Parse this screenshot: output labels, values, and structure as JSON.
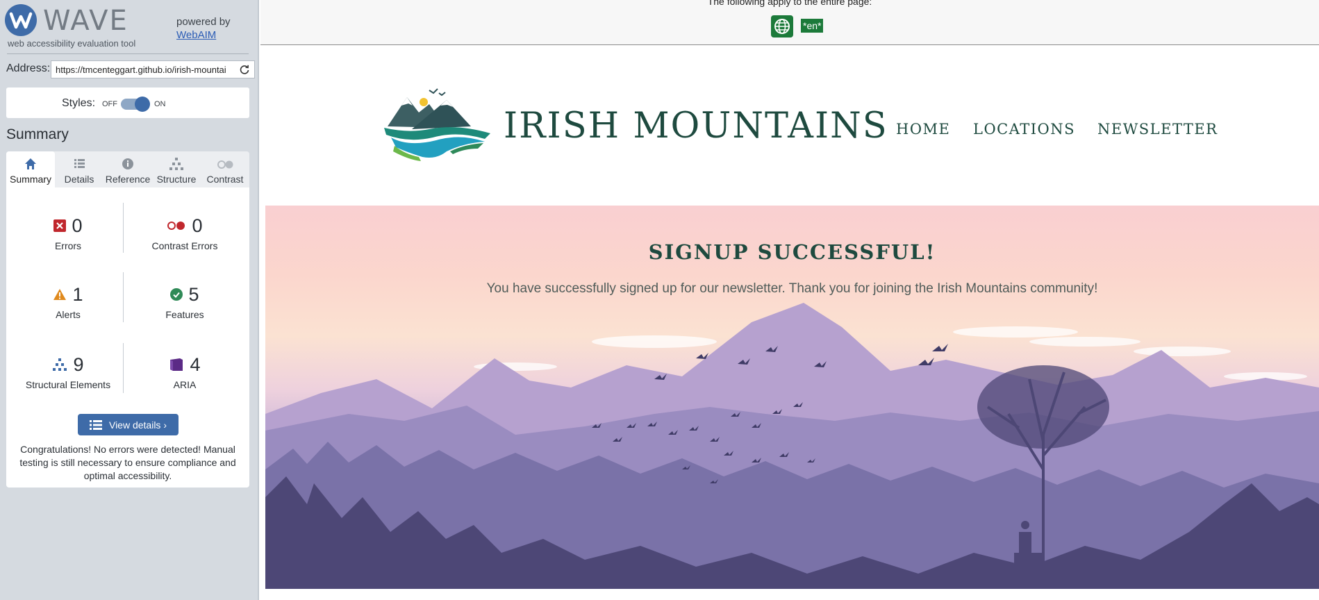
{
  "wave": {
    "title": "WAVE",
    "subtitle": "web accessibility evaluation tool",
    "powered_by": "powered by",
    "webaim_link": "WebAIM",
    "address_label": "Address:",
    "address_value": "https://tmcenteggart.github.io/irish-mountai",
    "styles_label": "Styles:",
    "styles_off": "OFF",
    "styles_on": "ON",
    "styles_state": "on",
    "summary_heading": "Summary",
    "tabs": [
      {
        "label": "Summary",
        "icon": "home-icon"
      },
      {
        "label": "Details",
        "icon": "list-icon"
      },
      {
        "label": "Reference",
        "icon": "info-icon"
      },
      {
        "label": "Structure",
        "icon": "structure-icon"
      },
      {
        "label": "Contrast",
        "icon": "contrast-icon"
      }
    ],
    "stats": {
      "errors": {
        "count": "0",
        "label": "Errors"
      },
      "contrast_errors": {
        "count": "0",
        "label": "Contrast Errors"
      },
      "alerts": {
        "count": "1",
        "label": "Alerts"
      },
      "features": {
        "count": "5",
        "label": "Features"
      },
      "structural": {
        "count": "9",
        "label": "Structural Elements"
      },
      "aria": {
        "count": "4",
        "label": "ARIA"
      }
    },
    "view_details": "View details ›",
    "congrats": "Congratulations! No errors were detected! Manual testing is still necessary to ensure compliance and optimal accessibility.",
    "colors": {
      "accent": "#3e6ba8",
      "error": "#c0272d",
      "alert": "#e08a1e",
      "feature": "#2f8a57",
      "aria": "#5b2a86"
    }
  },
  "page": {
    "applies_text": "The following apply to the entire page:",
    "lang_badge": "*en*",
    "site_title": "IRISH MOUNTAINS",
    "nav": [
      "HOME",
      "LOCATIONS",
      "NEWSLETTER"
    ],
    "hero_title": "SIGNUP SUCCESSFUL!",
    "hero_text": "You have successfully signed up for our newsletter. Thank you for joining the Irish Mountains community!",
    "colors": {
      "brand": "#1e4a3f",
      "badge": "#1c7a3a"
    }
  }
}
